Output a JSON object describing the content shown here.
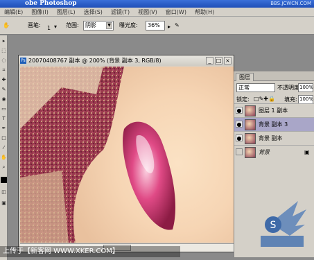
{
  "app": {
    "title": "obe Photoshop",
    "watermark": "BBS.JCWCN.COM"
  },
  "menu": [
    "编辑(E)",
    "图像(I)",
    "图层(L)",
    "选择(S)",
    "滤镜(T)",
    "视图(V)",
    "窗口(W)",
    "帮助(H)"
  ],
  "options": {
    "brush_label": "画笔:",
    "brush_size": "1",
    "range_label": "范围:",
    "range_value": "阴影",
    "exposure_label": "曝光度:",
    "exposure_value": "36%"
  },
  "document": {
    "title": "20070408767 副本 @ 200% (背景 副本 3, RGB/8)",
    "ps_icon_text": "Ps"
  },
  "layers_panel": {
    "tab_label": "图层",
    "blend_mode": "正常",
    "opacity_label": "不透明度:",
    "opacity_value": "100%",
    "lock_label": "锁定:",
    "fill_label": "填充:",
    "fill_value": "100%",
    "layers": [
      {
        "name": "图层 1 副本",
        "selected": false,
        "locked": false
      },
      {
        "name": "背景 副本 3",
        "selected": true,
        "locked": false
      },
      {
        "name": "背景 副本",
        "selected": false,
        "locked": false
      },
      {
        "name": "背景",
        "selected": false,
        "locked": true
      }
    ]
  },
  "banner": {
    "text": "上传于【新客网 WWW.XKER.COM】"
  },
  "colors": {
    "titlebar": "#2a5fc8",
    "panel": "#d4d0c8",
    "selected_layer": "#a9a6c8"
  }
}
